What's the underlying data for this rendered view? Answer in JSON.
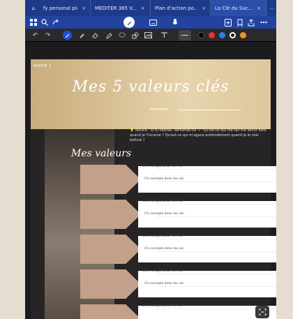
{
  "tabs": [
    {
      "label": "fy personal pla...",
      "active": false
    },
    {
      "label": "MÉDITER 365 V...",
      "active": false
    },
    {
      "label": "Plan d'action po...",
      "active": false
    },
    {
      "label": "La Clé du Suc...",
      "active": true
    }
  ],
  "tab_close_glyph": "×",
  "tab_more_glyph": "⋯",
  "toolbar": {
    "left_icons": [
      "grid-icon",
      "search-icon",
      "share-pages-icon"
    ],
    "center_icons": [
      "pen-mode-icon",
      "keyboard-icon",
      "mic-icon"
    ],
    "right_icons": [
      "add-page-icon",
      "bookmark-icon",
      "export-icon",
      "more-icon"
    ]
  },
  "pen_toolbar": {
    "tools": [
      "undo-icon",
      "redo-icon",
      "pen-icon",
      "pencil-icon",
      "eraser-icon",
      "highlighter-icon",
      "lasso-icon",
      "shape-icon",
      "image-icon",
      "text-icon"
    ],
    "colors": [
      "#000000",
      "#e5322d",
      "#2f7fe6",
      "#1a1a1a",
      "#f0921a"
    ]
  },
  "document": {
    "partie": "PARTIE 1",
    "title": "Mes 5 valeurs clés",
    "subtitle": "Worksheet",
    "astuce": "💡 Astuce : Si tu hésites, demande-toi → \"Qu'est-ce qui me fait me sentir fière quand je l'incarne ? Qu'est-ce qui m'agace profondément quand je le vois bafoué ?",
    "section_title": "Mes valeurs",
    "rows": [
      {
        "line1": "Elle compte pour moi car",
        "line2": "Un exemple dans ma vie:"
      },
      {
        "line1": "Elle compte pour moi car",
        "line2": "Un exemple dans ma vie:"
      },
      {
        "line1": "Elle compte pour moi car",
        "line2": "Un exemple dans ma vie:"
      },
      {
        "line1": "Elle compte pour moi car",
        "line2": "Un exemple dans ma vie:"
      },
      {
        "line1": "Elle compte pour moi car",
        "line2": ""
      }
    ]
  }
}
